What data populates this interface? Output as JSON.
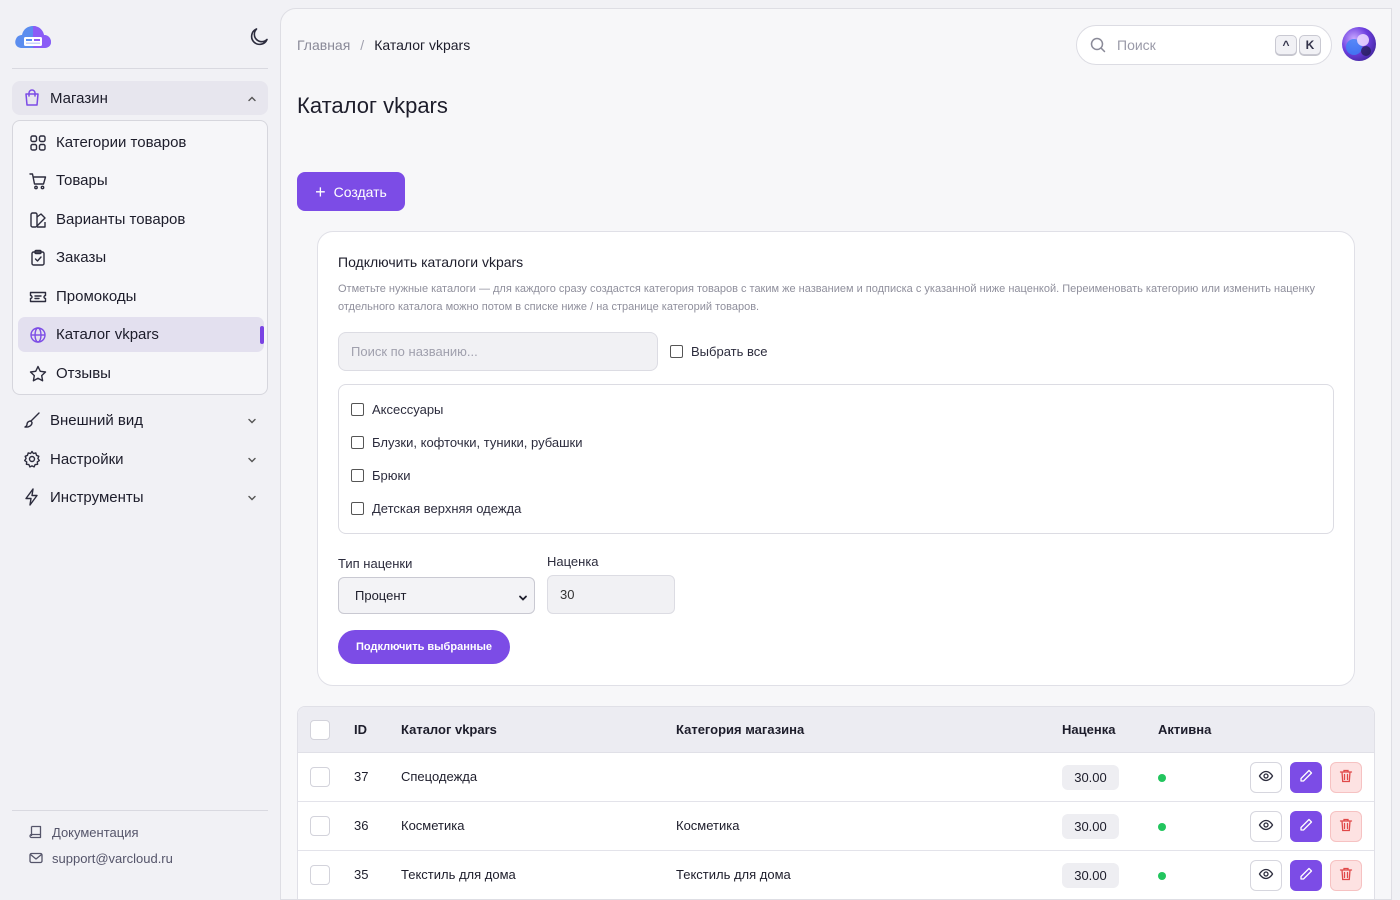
{
  "sidebar": {
    "groups": {
      "shop": "Магазин",
      "appearance": "Внешний вид",
      "settings": "Настройки",
      "tools": "Инструменты"
    },
    "items": [
      {
        "label": "Категории товаров",
        "icon": "grid-icon"
      },
      {
        "label": "Товары",
        "icon": "cart-icon"
      },
      {
        "label": "Варианты товаров",
        "icon": "swatches-icon"
      },
      {
        "label": "Заказы",
        "icon": "clipboard-icon"
      },
      {
        "label": "Промокоды",
        "icon": "ticket-icon"
      },
      {
        "label": "Каталог vkpars",
        "icon": "globe-icon",
        "active": true
      },
      {
        "label": "Отзывы",
        "icon": "star-icon"
      }
    ],
    "footer": {
      "docs": "Документация",
      "email": "support@varcloud.ru"
    }
  },
  "header": {
    "breadcrumb_home": "Главная",
    "breadcrumb_sep": "/",
    "breadcrumb_current": "Каталог vkpars",
    "search_placeholder": "Поиск",
    "kbd_1": "^",
    "kbd_2": "K"
  },
  "page": {
    "title": "Каталог vkpars",
    "create_label": "Создать"
  },
  "connect": {
    "title": "Подключить каталоги vkpars",
    "description": "Отметьте нужные каталоги — для каждого сразу создастся категория товаров с таким же названием и подписка с указанной ниже наценкой. Переименовать категорию или изменить наценку отдельного каталога можно потом в списке ниже / на странице категорий товаров.",
    "search_placeholder": "Поиск по названию...",
    "select_all": "Выбрать все",
    "catalogs": [
      "Аксессуары",
      "Блузки, кофточки, туники, рубашки",
      "Брюки",
      "Детская верхняя одежда"
    ],
    "markup_type_label": "Тип наценки",
    "markup_type_value": "Процент",
    "markup_label": "Наценка",
    "markup_value": "30",
    "submit_label": "Подключить выбранные"
  },
  "table": {
    "headers": {
      "id": "ID",
      "catalog": "Каталог vkpars",
      "category": "Категория магазина",
      "markup": "Наценка",
      "active": "Активна"
    },
    "rows": [
      {
        "id": "37",
        "catalog": "Спецодежда",
        "category": "",
        "markup": "30.00"
      },
      {
        "id": "36",
        "catalog": "Косметика",
        "category": "Косметика",
        "markup": "30.00"
      },
      {
        "id": "35",
        "catalog": "Текстиль для дома",
        "category": "Текстиль для дома",
        "markup": "30.00"
      }
    ]
  },
  "colors": {
    "accent": "#7c4ce6",
    "active_dot": "#22c55e",
    "danger_bg": "#fde2e2"
  }
}
